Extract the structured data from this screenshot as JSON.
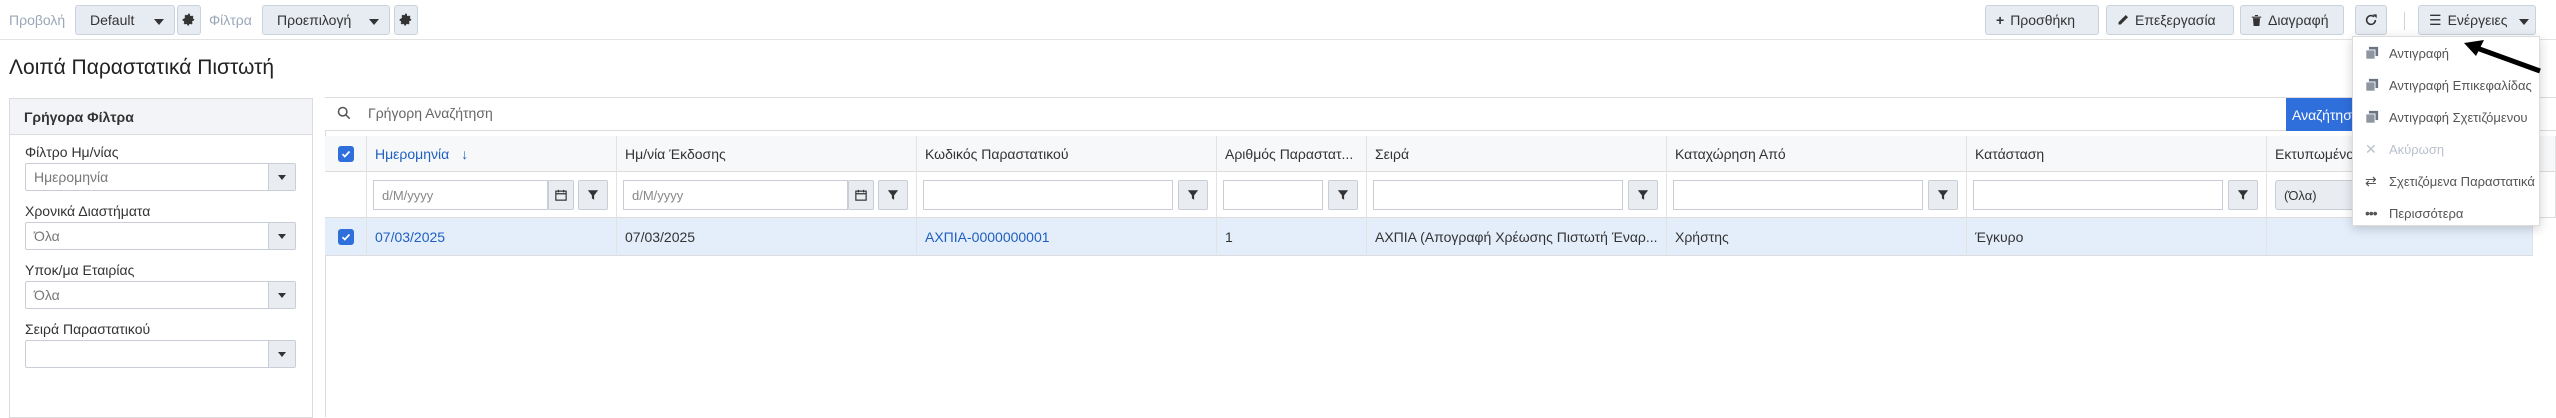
{
  "toolbar": {
    "view_label": "Προβολή",
    "view_value": "Default",
    "filter_label": "Φίλτρα",
    "filter_value": "Προεπιλογή",
    "add_label": "Προσθήκη",
    "edit_label": "Επεξεργασία",
    "delete_label": "Διαγραφή",
    "actions_label": "Ενέργειες"
  },
  "page_title": "Λοιπά Παραστατικά Πιστωτή",
  "quick_filters": {
    "header": "Γρήγορα Φίλτρα",
    "fields": [
      {
        "label": "Φίλτρο Ημ/νίας",
        "placeholder": "Ημερομηνία"
      },
      {
        "label": "Χρονικά Διαστήματα",
        "value": "Όλα"
      },
      {
        "label": "Υποκ/μα Εταιρίας",
        "value": "Όλα"
      },
      {
        "label": "Σειρά Παραστατικού",
        "value": ""
      }
    ]
  },
  "search": {
    "placeholder": "Γρήγορη Αναζήτηση",
    "button_label": "Αναζήτηση"
  },
  "grid": {
    "columns": [
      "Ημερομηνία",
      "Ημ/νία Έκδοσης",
      "Κωδικός Παραστατικού",
      "Αριθμός Παραστατ...",
      "Σειρά",
      "Καταχώρηση Από",
      "Κατάσταση",
      "Εκτυπωμένο"
    ],
    "sort_indicator": "↓",
    "date_placeholder": "d/M/yyyy",
    "status_filter_value": "(Όλα)",
    "rows": [
      {
        "date": "07/03/2025",
        "issue_date": "07/03/2025",
        "code": "ΑΧΠΙΑ-0000000001",
        "number": "1",
        "series": "ΑΧΠΙΑ (Απογραφή Χρέωσης Πιστωτή Έναρ...",
        "entered_by": "Χρήστης",
        "status": "Έγκυρο"
      }
    ]
  },
  "actions_menu": {
    "items": [
      {
        "label": "Αντιγραφή",
        "icon": "copy-icon",
        "disabled": false
      },
      {
        "label": "Αντιγραφή Επικεφαλίδας",
        "icon": "copy-icon",
        "disabled": false
      },
      {
        "label": "Αντιγραφή Σχετιζόμενου",
        "icon": "copy-icon",
        "disabled": false
      },
      {
        "label": "Ακύρωση",
        "icon": "close-icon",
        "disabled": true
      },
      {
        "label": "Σχετιζόμενα Παραστατικά",
        "icon": "exchange-icon",
        "disabled": false
      },
      {
        "label": "Περισσότερα",
        "icon": "more-icon",
        "disabled": false
      }
    ]
  },
  "colors": {
    "accent": "#2f6fdc",
    "link": "#1f5fbf",
    "selected_row": "#e4eefb",
    "button_bg": "#e7ecf2"
  }
}
